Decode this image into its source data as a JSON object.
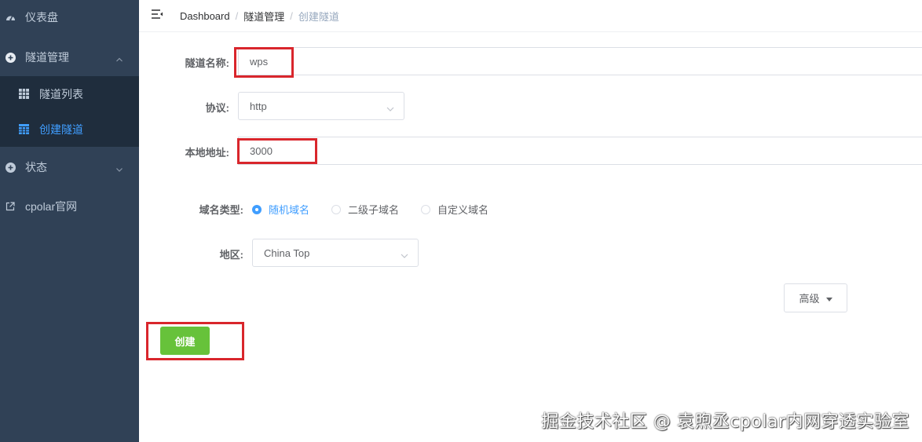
{
  "sidebar": {
    "dashboard": "仪表盘",
    "tunnel_mgmt": "隧道管理",
    "tunnel_list": "隧道列表",
    "create_tunnel": "创建隧道",
    "status": "状态",
    "official_site": "cpolar官网"
  },
  "breadcrumb": [
    "Dashboard",
    "隧道管理",
    "创建隧道"
  ],
  "form": {
    "name_label": "隧道名称:",
    "name_value": "wps",
    "protocol_label": "协议:",
    "protocol_value": "http",
    "local_label": "本地地址:",
    "local_value": "3000",
    "domain_type_label": "域名类型:",
    "domain_options": [
      "随机域名",
      "二级子域名",
      "自定义域名"
    ],
    "domain_selected": "随机域名",
    "region_label": "地区:",
    "region_value": "China Top",
    "advanced_label": "高级",
    "create_label": "创建"
  },
  "watermark": "掘金技术社区 @ 袁煦丞cpolar内网穿透实验室",
  "colors": {
    "sidebar_bg": "#304156",
    "submenu_bg": "#1f2d3d",
    "active_blue": "#409eff",
    "success_green": "#67c23a",
    "highlight_red": "#d9262c"
  }
}
